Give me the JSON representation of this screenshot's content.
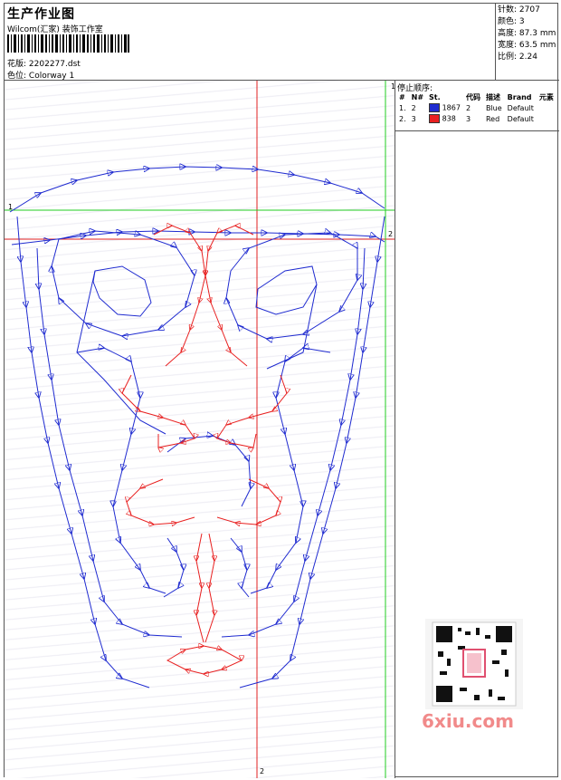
{
  "header": {
    "title": "生产作业图",
    "vendor": "Wilcom(汇家) 装饰工作室",
    "design_label": "花版:",
    "design_file": "2202277.dst",
    "colorway_label": "色位:",
    "colorway": "Colorway 1"
  },
  "stats": [
    {
      "label": "针数:",
      "value": "2707"
    },
    {
      "label": "颜色:",
      "value": "3"
    },
    {
      "label": "高度:",
      "value": "87.3 mm"
    },
    {
      "label": "宽度:",
      "value": "63.5 mm"
    },
    {
      "label": "比例:",
      "value": "2.24"
    }
  ],
  "stop_sequence": {
    "title": "停止顺序:",
    "columns": [
      "#",
      "N#",
      "St.",
      "代码",
      "描述",
      "Brand",
      "元素"
    ],
    "rows": [
      {
        "idx": "1.",
        "n": "2",
        "color": "#1f2bd0",
        "stitches": "1867",
        "code": "2",
        "desc": "Blue",
        "brand": "Default"
      },
      {
        "idx": "2.",
        "n": "3",
        "color": "#e82020",
        "stitches": "838",
        "code": "3",
        "desc": "Red",
        "brand": "Default"
      }
    ]
  },
  "axis_labels": {
    "top": "1",
    "bottom": "2",
    "left": "1",
    "right": "2"
  },
  "watermark": "6xiu.com",
  "colors": {
    "blue": "#1f2bd0",
    "red": "#e82020",
    "guide_green": "#22cc22",
    "guide_red": "#e02020"
  }
}
